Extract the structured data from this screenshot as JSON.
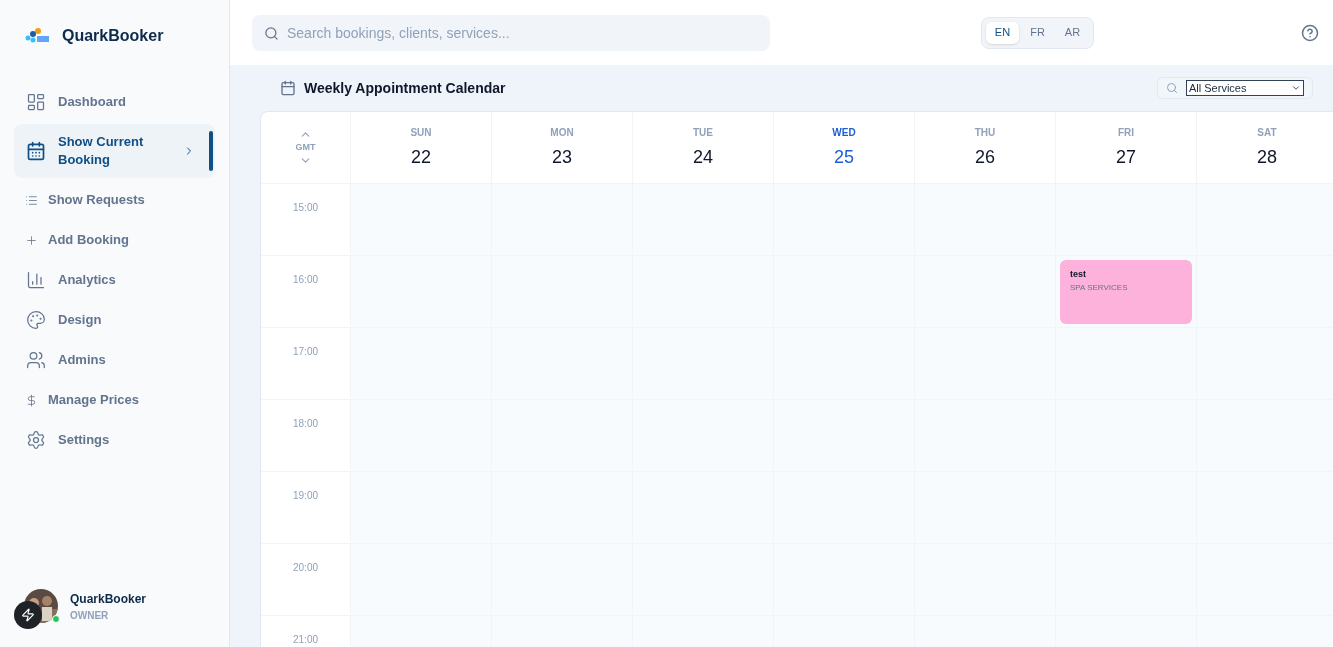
{
  "brand": {
    "name": "QuarkBooker"
  },
  "sidebar": {
    "items": [
      {
        "label": "Dashboard",
        "kind": "main",
        "selected": false
      },
      {
        "label": "Show Current Booking",
        "kind": "main",
        "selected": true
      },
      {
        "label": "Show Requests",
        "kind": "sub",
        "selected": false
      },
      {
        "label": "Add Booking",
        "kind": "sub",
        "selected": false
      },
      {
        "label": "Analytics",
        "kind": "main",
        "selected": false
      },
      {
        "label": "Design",
        "kind": "main",
        "selected": false
      },
      {
        "label": "Admins",
        "kind": "main",
        "selected": false
      },
      {
        "label": "Manage Prices",
        "kind": "sub",
        "selected": false
      },
      {
        "label": "Settings",
        "kind": "main",
        "selected": false
      }
    ]
  },
  "user": {
    "name": "QuarkBooker",
    "role": "OWNER",
    "online": true
  },
  "search": {
    "placeholder": "Search bookings, clients, services..."
  },
  "languages": [
    {
      "label": "EN",
      "selected": true
    },
    {
      "label": "FR",
      "selected": false
    },
    {
      "label": "AR",
      "selected": false
    }
  ],
  "calendar": {
    "title": "Weekly Appointment Calendar",
    "filter": {
      "value": "All Services"
    },
    "timezone": "GMT",
    "days": [
      {
        "name": "SUN",
        "date": "22",
        "selected": false
      },
      {
        "name": "MON",
        "date": "23",
        "selected": false
      },
      {
        "name": "TUE",
        "date": "24",
        "selected": false
      },
      {
        "name": "WED",
        "date": "25",
        "selected": true
      },
      {
        "name": "THU",
        "date": "26",
        "selected": false
      },
      {
        "name": "FRI",
        "date": "27",
        "selected": false
      },
      {
        "name": "SAT",
        "date": "28",
        "selected": false
      }
    ],
    "hours": [
      {
        "time": "15:00",
        "cells": [
          {
            "kind": "empty"
          },
          {
            "kind": "empty"
          },
          {
            "kind": "empty"
          },
          {
            "kind": "empty"
          },
          {
            "kind": "empty"
          },
          {
            "kind": "empty"
          },
          {
            "kind": "empty"
          }
        ]
      },
      {
        "time": "16:00",
        "cells": [
          {
            "kind": "empty"
          },
          {
            "kind": "empty"
          },
          {
            "kind": "empty"
          },
          {
            "kind": "empty"
          },
          {
            "kind": "empty"
          },
          {
            "kind": "appointment",
            "title": "test",
            "service": "SPA SERVICES",
            "color": "#fdb2dc"
          },
          {
            "kind": "empty"
          }
        ]
      },
      {
        "time": "17:00",
        "cells": [
          {
            "kind": "empty"
          },
          {
            "kind": "empty"
          },
          {
            "kind": "empty"
          },
          {
            "kind": "empty"
          },
          {
            "kind": "empty"
          },
          {
            "kind": "empty"
          },
          {
            "kind": "empty"
          }
        ]
      },
      {
        "time": "18:00",
        "cells": [
          {
            "kind": "empty"
          },
          {
            "kind": "empty"
          },
          {
            "kind": "empty"
          },
          {
            "kind": "empty"
          },
          {
            "kind": "empty"
          },
          {
            "kind": "empty"
          },
          {
            "kind": "empty"
          }
        ]
      },
      {
        "time": "19:00",
        "cells": [
          {
            "kind": "empty"
          },
          {
            "kind": "empty"
          },
          {
            "kind": "empty"
          },
          {
            "kind": "empty"
          },
          {
            "kind": "empty"
          },
          {
            "kind": "empty"
          },
          {
            "kind": "empty"
          }
        ]
      },
      {
        "time": "20:00",
        "cells": [
          {
            "kind": "empty"
          },
          {
            "kind": "empty"
          },
          {
            "kind": "empty"
          },
          {
            "kind": "empty"
          },
          {
            "kind": "empty"
          },
          {
            "kind": "empty"
          },
          {
            "kind": "empty"
          }
        ]
      },
      {
        "time": "21:00",
        "cells": [
          {
            "kind": "empty"
          },
          {
            "kind": "empty"
          },
          {
            "kind": "empty"
          },
          {
            "kind": "empty"
          },
          {
            "kind": "empty"
          },
          {
            "kind": "empty"
          },
          {
            "kind": "empty"
          }
        ]
      }
    ]
  }
}
